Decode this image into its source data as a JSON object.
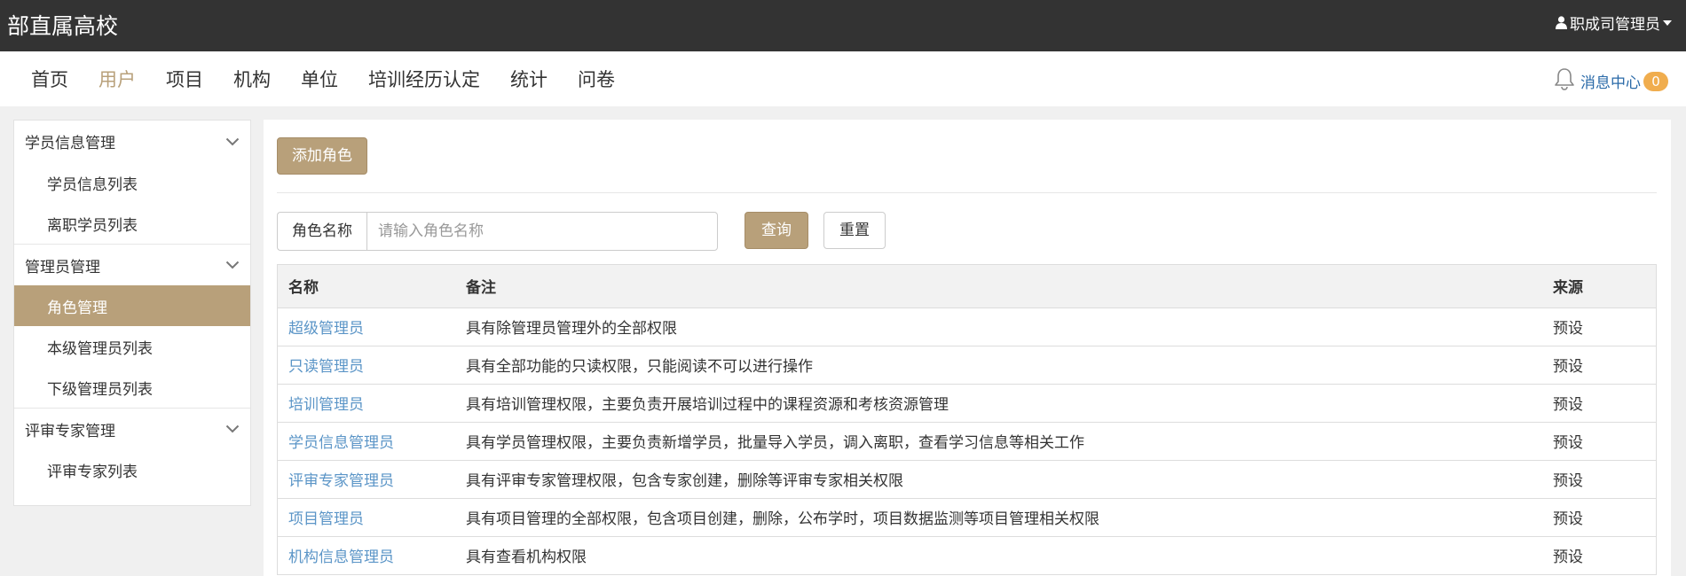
{
  "header": {
    "brand": "部直属高校",
    "user": "职成司管理员"
  },
  "nav": {
    "items": [
      "首页",
      "用户",
      "项目",
      "机构",
      "单位",
      "培训经历认定",
      "统计",
      "问卷"
    ],
    "active_index": 1,
    "message_center": "消息中心",
    "message_count": "0"
  },
  "sidebar": {
    "groups": [
      {
        "title": "学员信息管理",
        "items": [
          "学员信息列表",
          "离职学员列表"
        ]
      },
      {
        "title": "管理员管理",
        "items": [
          "角色管理",
          "本级管理员列表",
          "下级管理员列表"
        ]
      },
      {
        "title": "评审专家管理",
        "items": [
          "评审专家列表"
        ]
      }
    ],
    "active_item": "角色管理"
  },
  "main": {
    "add_button": "添加角色",
    "search": {
      "label": "角色名称",
      "placeholder": "请输入角色名称",
      "value": "",
      "query_button": "查询",
      "reset_button": "重置"
    },
    "table": {
      "columns": [
        "名称",
        "备注",
        "来源"
      ],
      "rows": [
        {
          "name": "超级管理员",
          "note": "具有除管理员管理外的全部权限",
          "source": "预设"
        },
        {
          "name": "只读管理员",
          "note": "具有全部功能的只读权限，只能阅读不可以进行操作",
          "source": "预设"
        },
        {
          "name": "培训管理员",
          "note": "具有培训管理权限，主要负责开展培训过程中的课程资源和考核资源管理",
          "source": "预设"
        },
        {
          "name": "学员信息管理员",
          "note": "具有学员管理权限，主要负责新增学员，批量导入学员，调入离职，查看学习信息等相关工作",
          "source": "预设"
        },
        {
          "name": "评审专家管理员",
          "note": "具有评审专家管理权限，包含专家创建，删除等评审专家相关权限",
          "source": "预设"
        },
        {
          "name": "项目管理员",
          "note": "具有项目管理的全部权限，包含项目创建，删除，公布学时，项目数据监测等项目管理相关权限",
          "source": "预设"
        },
        {
          "name": "机构信息管理员",
          "note": "具有查看机构权限",
          "source": "预设"
        }
      ]
    }
  },
  "colors": {
    "accent": "#b8a07a",
    "topbar": "#333333",
    "link": "#5b95c7",
    "badge": "#f0ad4e"
  }
}
